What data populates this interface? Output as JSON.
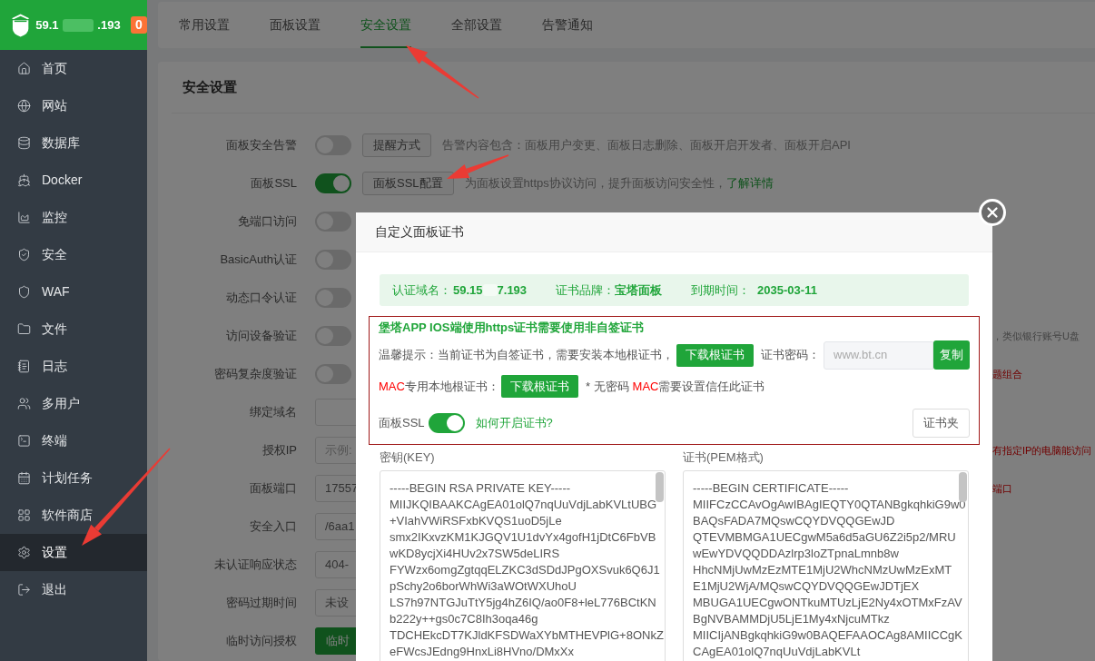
{
  "sidebar": {
    "host_start": "59.1",
    "host_end": ".193",
    "badge": "0",
    "items": [
      {
        "label": "首页",
        "selected": false
      },
      {
        "label": "网站",
        "selected": false
      },
      {
        "label": "数据库",
        "selected": false
      },
      {
        "label": "Docker",
        "selected": false
      },
      {
        "label": "监控",
        "selected": false
      },
      {
        "label": "安全",
        "selected": false
      },
      {
        "label": "WAF",
        "selected": false
      },
      {
        "label": "文件",
        "selected": false
      },
      {
        "label": "日志",
        "selected": false
      },
      {
        "label": "多用户",
        "selected": false
      },
      {
        "label": "终端",
        "selected": false
      },
      {
        "label": "计划任务",
        "selected": false
      },
      {
        "label": "软件商店",
        "selected": false
      },
      {
        "label": "设置",
        "selected": true
      },
      {
        "label": "退出",
        "selected": false
      }
    ]
  },
  "tabs": [
    {
      "label": "常用设置",
      "selected": false
    },
    {
      "label": "面板设置",
      "selected": false
    },
    {
      "label": "安全设置",
      "selected": true
    },
    {
      "label": "全部设置",
      "selected": false
    },
    {
      "label": "告警通知",
      "selected": false
    }
  ],
  "section_title": "安全设置",
  "settings": [
    {
      "kind": "toggle",
      "label": "面板安全告警",
      "on": false,
      "button": "提醒方式",
      "description": "告警内容包含：面板用户变更、面板日志删除、面板开启开发者、面板开启API"
    },
    {
      "kind": "toggle",
      "label": "面板SSL",
      "on": true,
      "button": "面板SSL配置",
      "description": "为面板设置https协议访问，提升面板访问安全性，",
      "link": "了解详情"
    },
    {
      "kind": "toggle",
      "label": "免端口访问",
      "on": false
    },
    {
      "kind": "toggle",
      "label": "BasicAuth认证",
      "on": false
    },
    {
      "kind": "toggle",
      "label": "动态口令认证",
      "on": false
    },
    {
      "kind": "toggle",
      "label": "访问设备验证",
      "on": false,
      "note": "，类似银行账号U盘"
    },
    {
      "kind": "toggle",
      "label": "密码复杂度验证",
      "on": false,
      "warning": "题组合"
    },
    {
      "kind": "input",
      "label": "绑定域名"
    },
    {
      "kind": "input",
      "label": "授权IP",
      "placeholder": "示例:",
      "warning": "有指定IP的电脑能访问"
    },
    {
      "kind": "input",
      "label": "面板端口",
      "value": "17557",
      "warning": "端口"
    },
    {
      "kind": "input",
      "label": "安全入口",
      "value": "/6aa1"
    },
    {
      "kind": "input",
      "label": "未认证响应状态",
      "value": "404-"
    },
    {
      "kind": "input",
      "label": "密码过期时间",
      "value": "未设"
    },
    {
      "kind": "button",
      "label": "临时访问授权",
      "button": "临时"
    }
  ],
  "modal": {
    "title": "自定义面板证书",
    "info": {
      "domain_label": "认证域名：",
      "domain_start": "59.15",
      "domain_end": "7.193",
      "brand_label": "证书品牌：",
      "brand": "宝塔面板",
      "expiry_label": "到期时间：",
      "expiry": "2035-03-11"
    },
    "notice": {
      "heading": "堡塔APP IOS端使用https证书需要使用非自签证书",
      "tip": "温馨提示：当前证书为自签证书，需要安装本地根证书，",
      "download": "下载根证书",
      "password_label": "证书密码：",
      "password_placeholder": "www.bt.cn",
      "copy": "复制",
      "mac_tag": "MAC",
      "mac_label": "专用本地根证书：",
      "mac_download": "下载根证书",
      "mac_note_start": "* 无密码",
      "mac_note_tag": "MAC",
      "mac_note_end": "需要设置信任此证书",
      "ssl_label": "面板SSL",
      "ssl_on": true,
      "help_link": "如何开启证书?",
      "folder_button": "证书夹"
    },
    "key_label": "密钥(KEY)",
    "key_lines": [
      "-----BEGIN RSA PRIVATE KEY-----",
      "MIIJKQIBAAKCAgEA01olQ7nqUuVdjLabKVLtUBG",
      "+VIahVWiRSFxbKVQS1uoD5jLe",
      "smx2IKxvzKM1KJGQV1U1dvYx4gofH1jDtC6FbVB",
      "wKD8ycjXi4HUv2x7SW5deLIRS",
      "FYWzx6omgZgtqqELZKC3dSDdJPgOXSvuk6Q6J1",
      "pSchy2o6borWhWi3aWOtWXUhoU",
      "LS7h97NTGJuTtY5jg4hZ6IQ/ao0F8+leL776BCtKN",
      "b222y++gs0c7C8Ih3oqa46g",
      "TDCHEkcDT7KJldKFSDWaXYbMTHEVPlG+8ONkZ",
      "eFWcsJEdng9HnxLi8HVno/DMxXx"
    ],
    "cert_label": "证书(PEM格式)",
    "cert_lines": [
      "-----BEGIN CERTIFICATE-----",
      "MIIFCzCCAvOgAwIBAgIEQTY0QTANBgkqhkiG9w0",
      "BAQsFADA7MQswCQYDVQQGEwJD",
      "QTEVMBMGA1UECgwM5a6d5aGU6Z2i5p2/MRU",
      "wEwYDVQQDDAzlrp3loZTpnaLmnb8w",
      "HhcNMjUwMzEzMTE1MjU2WhcNMzUwMzExMT",
      "E1MjU2WjA/MQswCQYDVQQGEwJDTjEX",
      "MBUGA1UECgwONTkuMTUzLjE2Ny4xOTMxFzAV",
      "BgNVBAMMDjU5LjE1My4xNjcuMTkz",
      "MIICIjANBgkqhkiG9w0BAQEFAAOCAg8AMIICCgK",
      "CAgEA01olQ7nqUuVdjLabKVLt"
    ]
  }
}
